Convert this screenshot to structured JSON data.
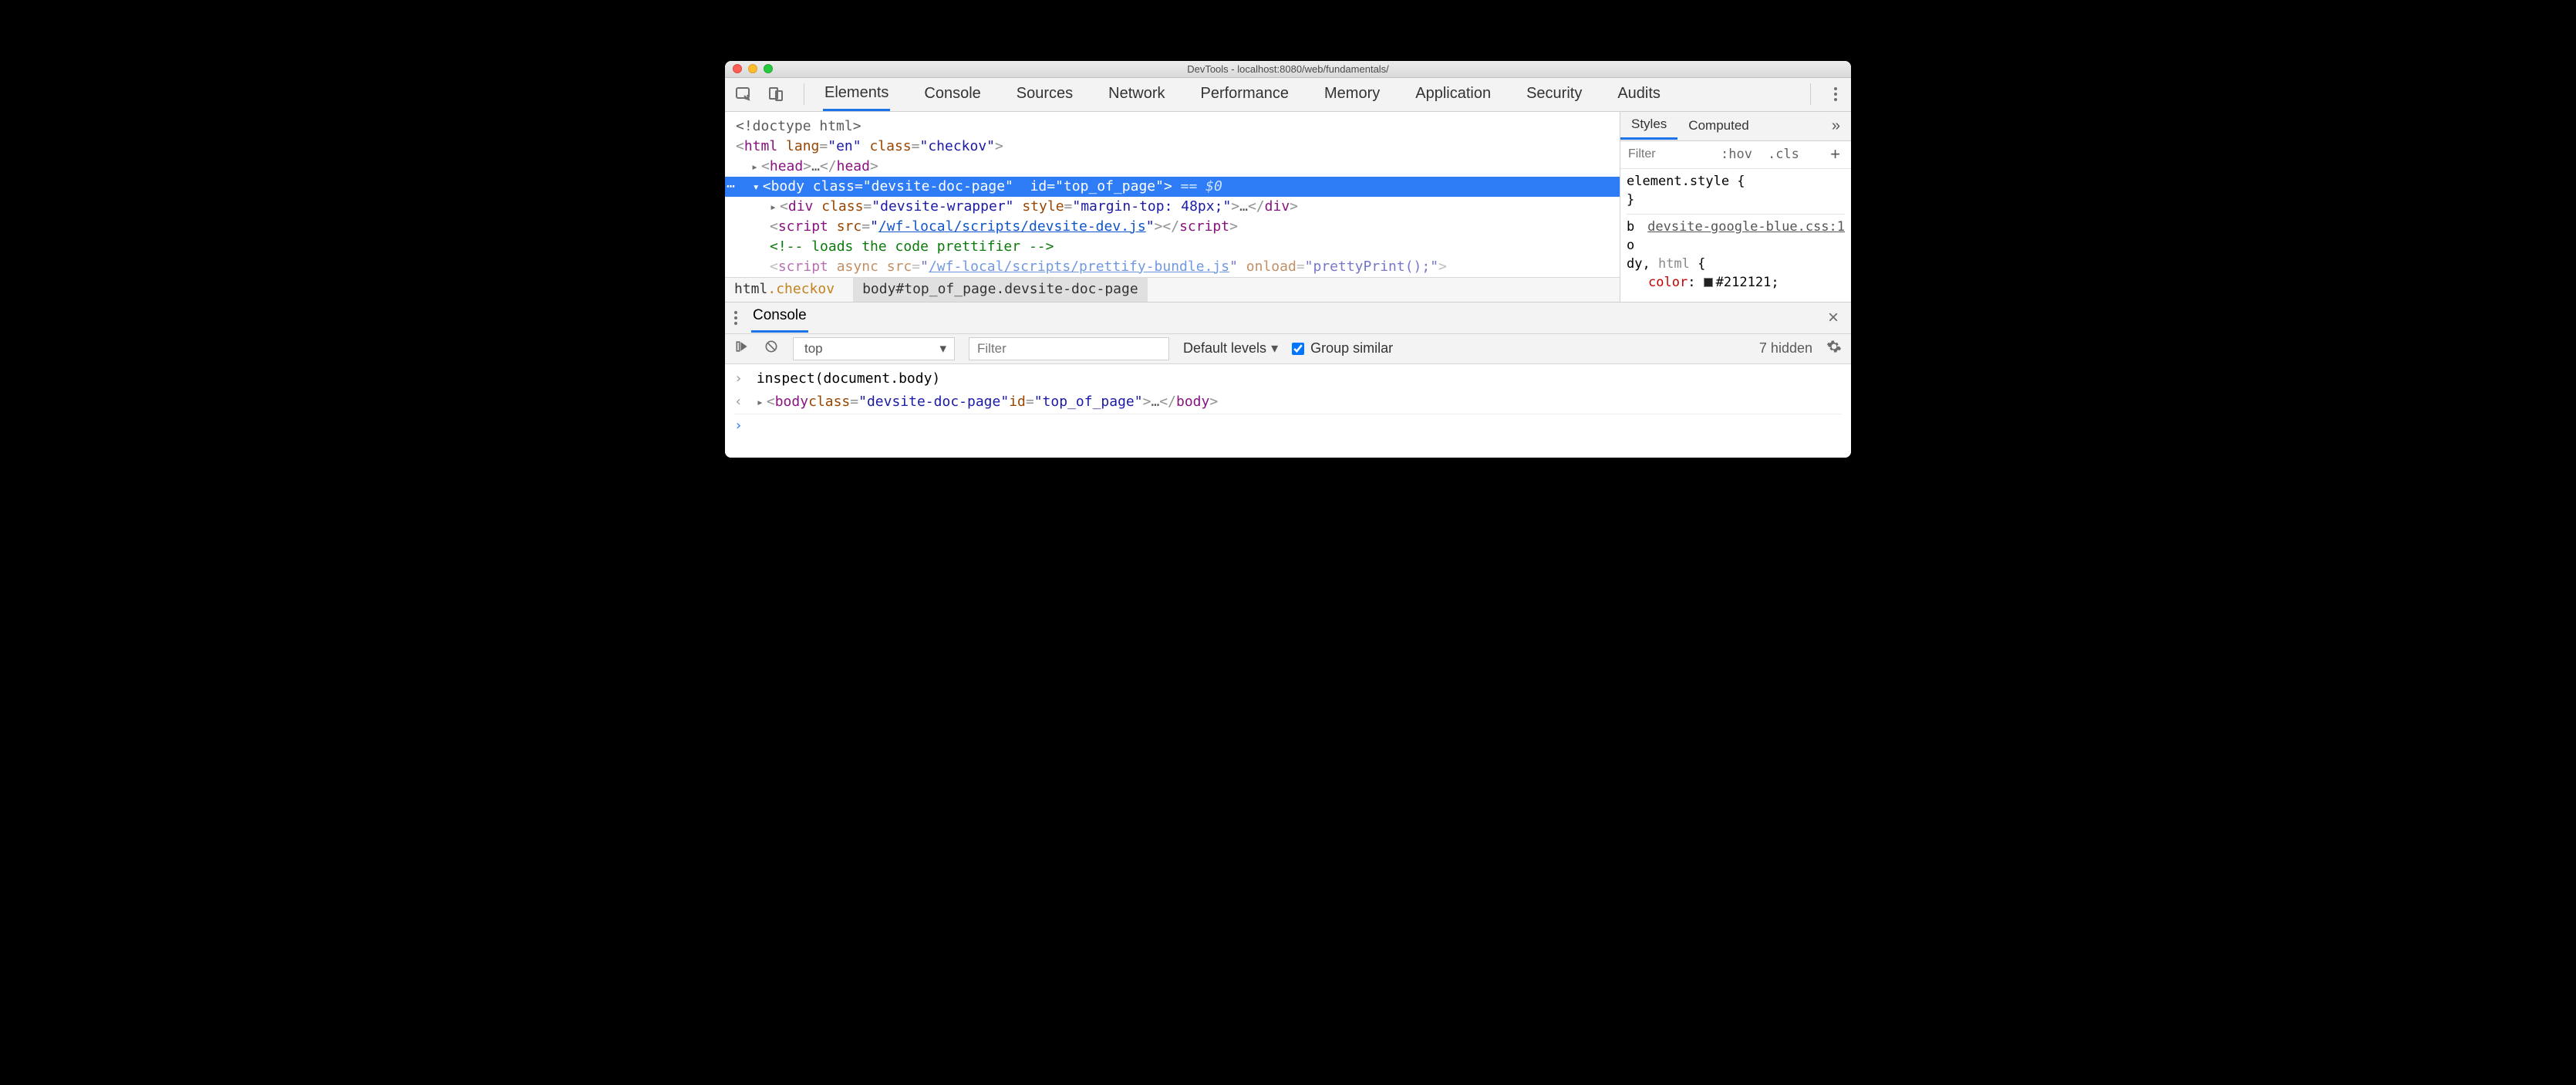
{
  "title": "DevTools - localhost:8080/web/fundamentals/",
  "tabs": [
    "Elements",
    "Console",
    "Sources",
    "Network",
    "Performance",
    "Memory",
    "Application",
    "Security",
    "Audits"
  ],
  "active_tab": "Elements",
  "dom": {
    "l1": "<!doctype html>",
    "l2_open": "<",
    "l2_tag": "html",
    "l2_a1n": "lang",
    "l2_a1v": "\"en\"",
    "l2_a2n": "class",
    "l2_a2v": "\"checkov\"",
    "l3_head": "head",
    "sel_tag": "body",
    "sel_a1n": "class",
    "sel_a1v": "\"devsite-doc-page\"",
    "sel_a2n": "id",
    "sel_a2v": "\"top_of_page\"",
    "sel_suf": " == $0",
    "l5_tag": "div",
    "l5_a1n": "class",
    "l5_a1v": "\"devsite-wrapper\"",
    "l5_a2n": "style",
    "l5_a2v": "\"margin-top: 48px;\"",
    "l6_tag": "script",
    "l6_an": "src",
    "l6_av": "/wf-local/scripts/devsite-dev.js",
    "l7_cmt": "<!-- loads the code prettifier -->",
    "l8_tag": "script",
    "l8_a1n": "async",
    "l8_a2n": "src",
    "l8_a2v": "/wf-local/scripts/prettify-bundle.js",
    "l8_a3n": "onload",
    "l8_a3v": "\"prettyPrint();\""
  },
  "crumbs": {
    "c1_pre": "html",
    "c1_cls": ".checkov",
    "c2": "body#top_of_page.devsite-doc-page"
  },
  "sidebar": {
    "tabs": [
      "Styles",
      "Computed"
    ],
    "active": "Styles",
    "more": "»",
    "filter_ph": "Filter",
    "hov": ":hov",
    "cls": ".cls",
    "plus": "+",
    "rule1_l1": "element.style {",
    "rule1_l2": "}",
    "rule2_sel_a": "b",
    "rule2_link": "devsite-google-blue.css:1",
    "rule2_sel_b": "o",
    "rule2_sel_c": "dy, ",
    "rule2_html": "html",
    "rule2_brace": " {",
    "rule2_prop": "color",
    "rule2_val": "#212121"
  },
  "drawer": {
    "tab": "Console",
    "context": "top",
    "filter_ph": "Filter",
    "levels": "Default levels",
    "group": "Group similar",
    "hidden": "7 hidden"
  },
  "console": {
    "l1": "inspect(document.body)",
    "l2_tag": "body",
    "l2_a1n": "class",
    "l2_a1v": "\"devsite-doc-page\"",
    "l2_a2n": "id",
    "l2_a2v": "\"top_of_page\""
  }
}
